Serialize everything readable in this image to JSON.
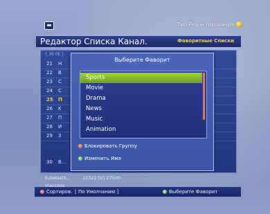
{
  "topbar": {
    "mode_text": "Тип Редактирования",
    "icon": "tv-icon"
  },
  "header": {
    "title": "Редактор Списка Канал.",
    "favorites_label": "Фаворитные Списки"
  },
  "list": {
    "top_text": "[ 36 0E ]",
    "rows": [
      {
        "num": "21",
        "name": "H"
      },
      {
        "num": "22",
        "name": "B"
      },
      {
        "num": "23",
        "name": "C"
      },
      {
        "num": "24",
        "name": "C"
      },
      {
        "num": "25",
        "name": "П"
      },
      {
        "num": "26",
        "name": "K"
      },
      {
        "num": "27",
        "name": "П"
      },
      {
        "num": "28",
        "name": "И"
      },
      {
        "num": "29",
        "name": "3"
      },
      {
        "num": "30",
        "name": "B..."
      }
    ],
    "active_index": 4,
    "info_satellite": "EutelsatS...",
    "info_freq": "12322 [V] 27500",
    "info_provider": "Viaccess"
  },
  "popup": {
    "title": "Выберите Фаворит",
    "items": [
      "Sports",
      "Movie",
      "Drama",
      "News",
      "Music",
      "Animation"
    ],
    "selected_index": 0,
    "action_lock": "Блокировать Группу",
    "action_rename": "Изменить Имя"
  },
  "bottom": {
    "sort_label": "Сортиров.",
    "sort_value": "[ По Умолчанию ]",
    "select_fav": "Выберите Фаворит"
  },
  "colors": {
    "accent_yellow": "#f4d73c",
    "selection_green": "#8cc22f",
    "scroll_orange": "#f07a22"
  }
}
